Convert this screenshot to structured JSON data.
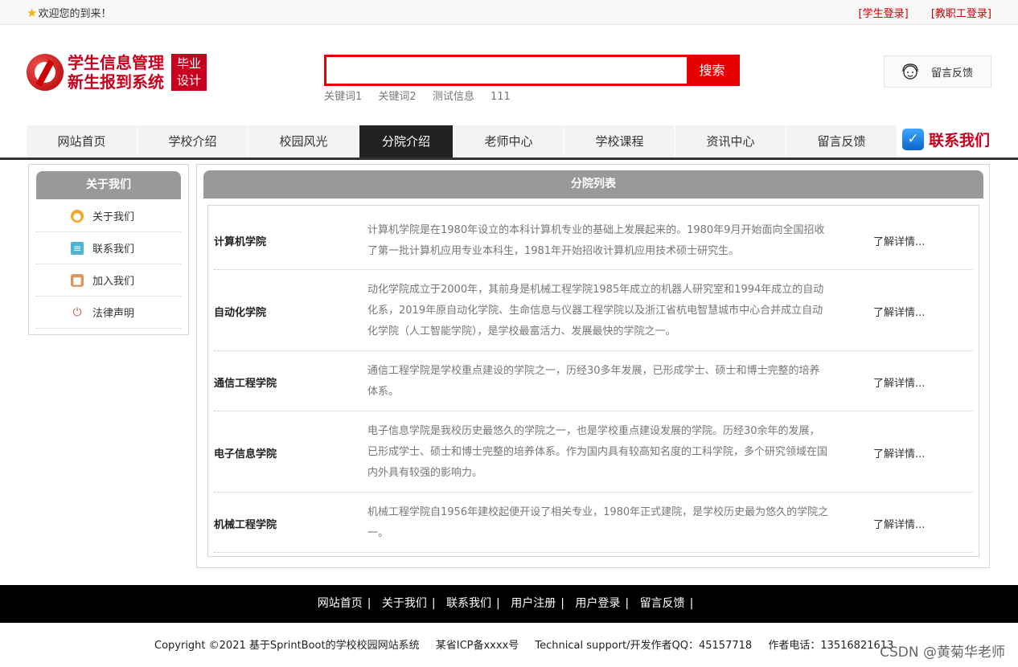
{
  "topbar": {
    "welcome": "欢迎您的到来！",
    "student_login": "[学生登录]",
    "staff_login": "[教职工登录]"
  },
  "logo": {
    "line1": "学生信息管理",
    "line2": "新生报到系统",
    "badge_line1": "毕业",
    "badge_line2": "设计"
  },
  "search": {
    "placeholder": "",
    "button": "搜索",
    "keywords": [
      "关键词1",
      "关键词2",
      "测试信息",
      "111"
    ]
  },
  "feedback_label": "留言反馈",
  "nav": {
    "items": [
      "网站首页",
      "学校介绍",
      "校园风光",
      "分院介绍",
      "老师中心",
      "学校课程",
      "资讯中心",
      "留言反馈"
    ],
    "active_index": 3,
    "contact": "联系我们"
  },
  "sidebar": {
    "title": "关于我们",
    "items": [
      {
        "label": "关于我们",
        "icon": "info-icon",
        "color": "#f5a623"
      },
      {
        "label": "联系我们",
        "icon": "clipboard-icon",
        "color": "#4db6d6"
      },
      {
        "label": "加入我们",
        "icon": "lock-icon",
        "color": "#e0955b"
      },
      {
        "label": "法律声明",
        "icon": "power-icon",
        "color": "#c0625a"
      }
    ]
  },
  "main": {
    "title": "分院列表",
    "more_label": "了解详情...",
    "rows": [
      {
        "name": "计算机学院",
        "desc": "计算机学院是在1980年设立的本科计算机专业的基础上发展起来的。1980年9月开始面向全国招收了第一批计算机应用专业本科生，1981年开始招收计算机应用技术硕士研究生。"
      },
      {
        "name": "自动化学院",
        "desc": "动化学院成立于2000年，其前身是机械工程学院1985年成立的机器人研究室和1994年成立的自动化系，2019年原自动化学院、生命信息与仪器工程学院以及浙江省杭电智慧城市中心合并成立自动化学院（人工智能学院），是学校最富活力、发展最快的学院之一。"
      },
      {
        "name": "通信工程学院",
        "desc": "通信工程学院是学校重点建设的学院之一，历经30多年发展，已形成学士、硕士和博士完整的培养体系。"
      },
      {
        "name": "电子信息学院",
        "desc": "电子信息学院是我校历史最悠久的学院之一，也是学校重点建设发展的学院。历经30余年的发展，已形成学士、硕士和博士完整的培养体系。作为国内具有较高知名度的工科学院，多个研究领域在国内外具有较强的影响力。"
      },
      {
        "name": "机械工程学院",
        "desc": "机械工程学院自1956年建校起便开设了相关专业，1980年正式建院，是学校历史最为悠久的学院之一。"
      }
    ]
  },
  "footer": {
    "links": [
      "网站首页",
      "关于我们",
      "联系我们",
      "用户注册",
      "用户登录",
      "留言反馈"
    ],
    "separator": "|",
    "copyright": "Copyright ©2021 基于SprintBoot的学校校园网站系统",
    "icp": "某省ICP备xxxx号",
    "support": "Technical support/开发作者QQ：45157718",
    "phone": "作者电话：13516821613",
    "watermark": "CSDN @黄菊华老师"
  }
}
